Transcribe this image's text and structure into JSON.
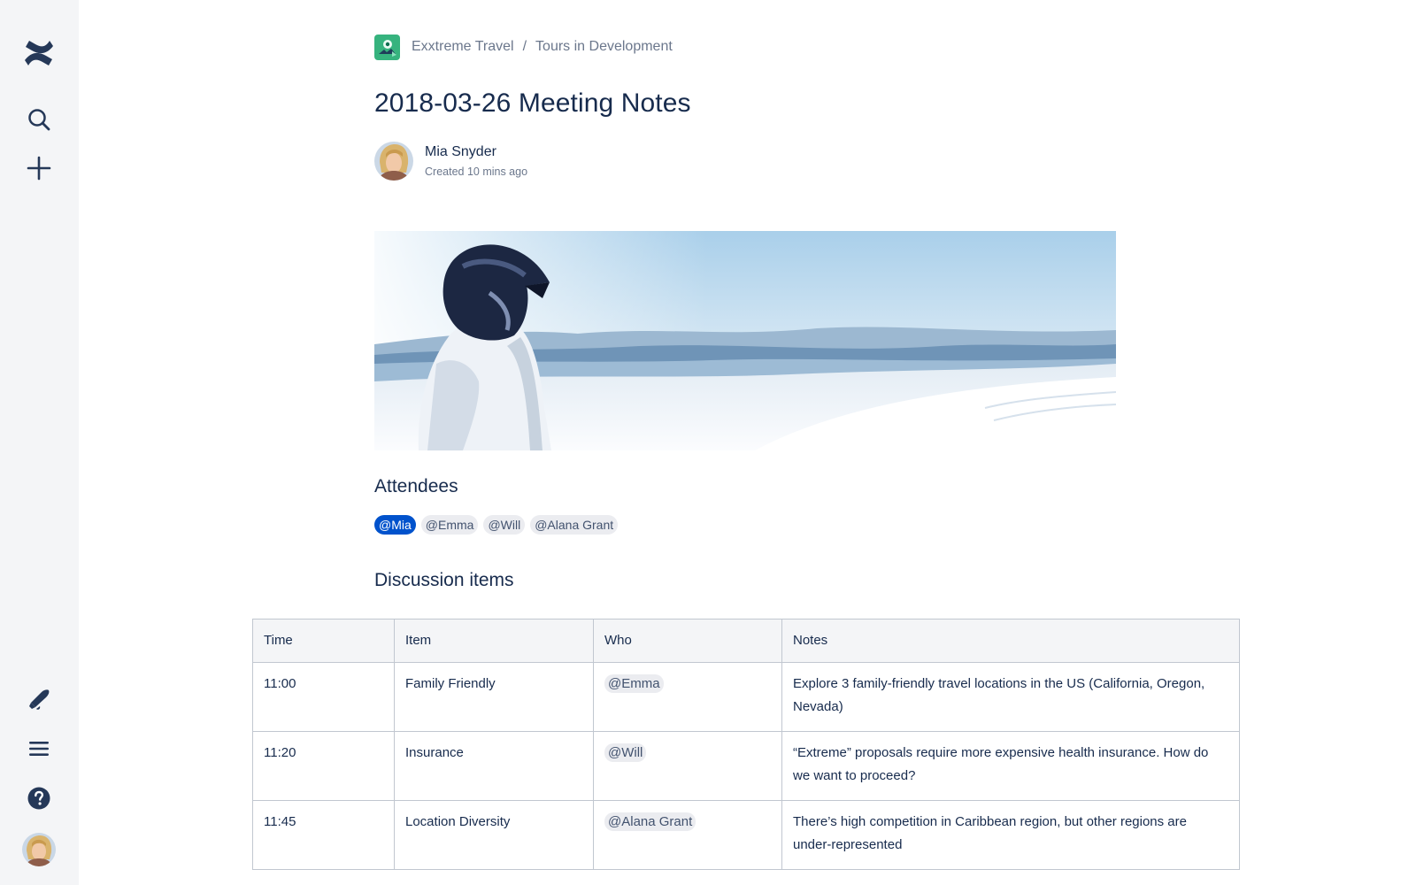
{
  "breadcrumb": {
    "space": "Exxtreme Travel",
    "separator": "/",
    "parent": "Tours in Development"
  },
  "page": {
    "title": "2018-03-26 Meeting Notes",
    "author": "Mia Snyder",
    "created": "Created 10 mins ago"
  },
  "sections": {
    "attendees_heading": "Attendees",
    "discussion_heading": "Discussion items"
  },
  "attendees": [
    "@Mia",
    "@Emma",
    "@Will",
    "@Alana Grant"
  ],
  "table": {
    "headers": [
      "Time",
      "Item",
      "Who",
      "Notes"
    ],
    "rows": [
      {
        "time": "11:00",
        "item": "Family Friendly",
        "who": "@Emma",
        "notes": "Explore 3 family-friendly travel locations in the US (California, Oregon, Nevada)"
      },
      {
        "time": "11:20",
        "item": "Insurance",
        "who": "@Will",
        "notes": "“Extreme” proposals require more expensive health insurance. How do we want to proceed?"
      },
      {
        "time": "11:45",
        "item": "Location Diversity",
        "who": "@Alana Grant",
        "notes": "There’s high competition in Caribbean region, but other regions are under-represented"
      }
    ]
  },
  "sidebar": {
    "icons": [
      "confluence-logo-icon",
      "search-icon",
      "create-icon",
      "notifications-icon",
      "menu-icon",
      "help-icon",
      "profile-avatar"
    ]
  },
  "colors": {
    "sidebar_bg": "#F4F5F7",
    "text": "#172B4D",
    "subtle_text": "#6B778C",
    "mention_self": "#0052CC",
    "mention_bg": "#EBECF0",
    "table_header_bg": "#F4F5F7",
    "border": "#C1C7D0"
  }
}
